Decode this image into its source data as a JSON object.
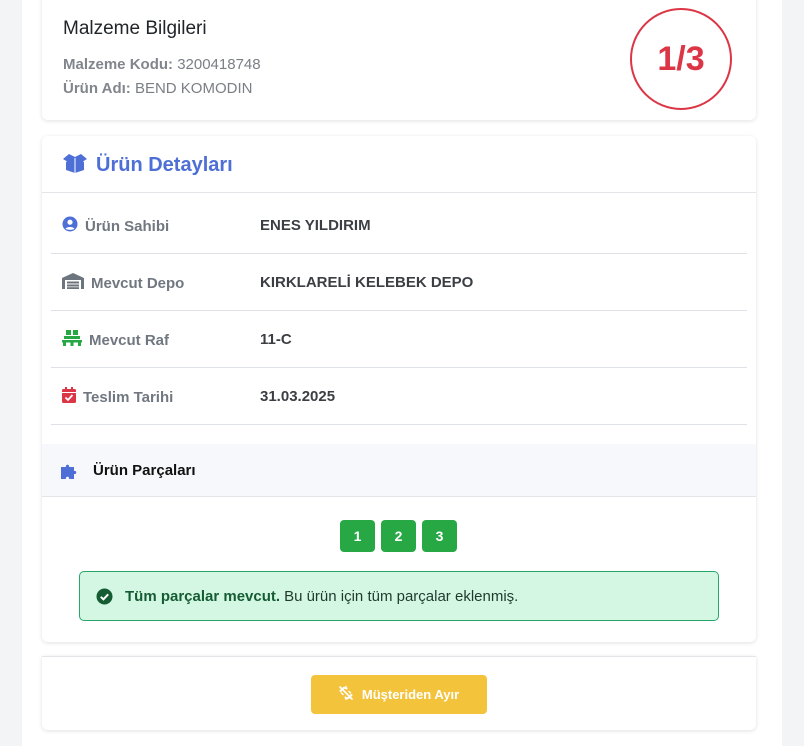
{
  "material": {
    "title": "Malzeme Bilgileri",
    "code_label": "Malzeme Kodu:",
    "code_value": "3200418748",
    "name_label": "Ürün Adı:",
    "name_value": "BEND KOMODIN",
    "counter": "1/3"
  },
  "details": {
    "title": "Ürün Detayları",
    "rows": [
      {
        "label": "Ürün Sahibi",
        "value": "ENES YILDIRIM",
        "icon": "user-circle-icon",
        "icon_color": "#4d6fd6"
      },
      {
        "label": "Mevcut Depo",
        "value": "KIRKLARELİ KELEBEK DEPO",
        "icon": "warehouse-icon",
        "icon_color": "#6c757d"
      },
      {
        "label": "Mevcut Raf",
        "value": "11-C",
        "icon": "pallet-icon",
        "icon_color": "#28a745"
      },
      {
        "label": "Teslim Tarihi",
        "value": "31.03.2025",
        "icon": "calendar-check-icon",
        "icon_color": "#dc3545"
      }
    ]
  },
  "parts": {
    "title": "Ürün Parçaları",
    "pages": [
      "1",
      "2",
      "3"
    ],
    "alert_bold": "Tüm parçalar mevcut.",
    "alert_text": "Bu ürün için tüm parçalar eklenmiş."
  },
  "actions": {
    "detach_label": "Müşteriden Ayır"
  },
  "colors": {
    "accent": "#4d6fd6",
    "success": "#28a745",
    "danger": "#dc3545",
    "warning": "#f4c33c"
  }
}
